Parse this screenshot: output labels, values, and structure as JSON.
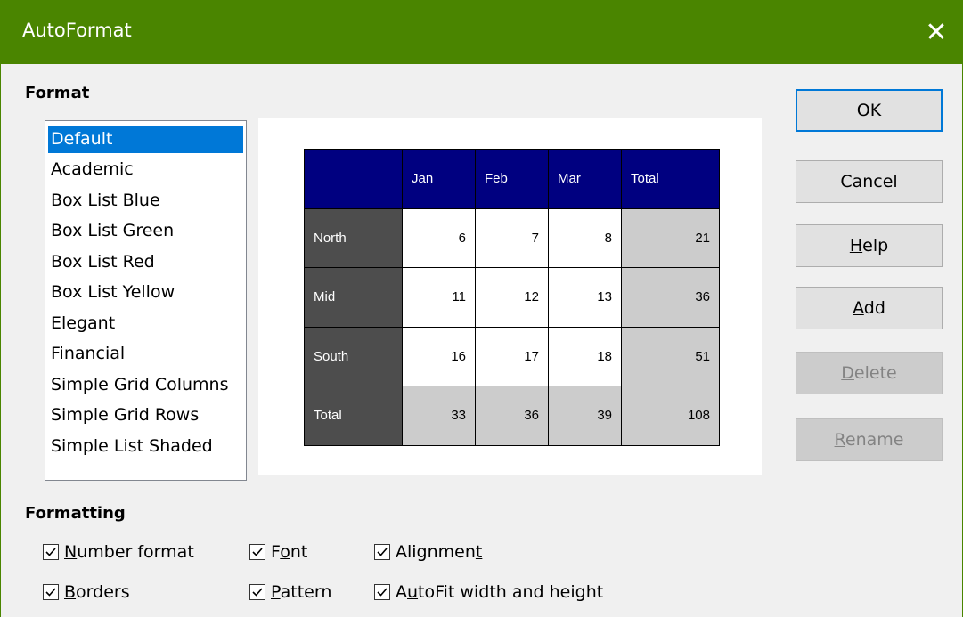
{
  "window": {
    "title": "AutoFormat",
    "close_glyph": "✕",
    "title_bar_color": "#4a8500"
  },
  "format_section": {
    "label": "Format",
    "items": [
      "Default",
      "Academic",
      "Box List Blue",
      "Box List Green",
      "Box List Red",
      "Box List Yellow",
      "Elegant",
      "Financial",
      "Simple Grid Columns",
      "Simple Grid Rows",
      "Simple List Shaded"
    ],
    "selected": "Default"
  },
  "preview": {
    "columns": [
      "",
      "Jan",
      "Feb",
      "Mar",
      "Total"
    ],
    "rows": [
      {
        "label": "North",
        "values": [
          "6",
          "7",
          "8"
        ],
        "total": "21"
      },
      {
        "label": "Mid",
        "values": [
          "11",
          "12",
          "13"
        ],
        "total": "36"
      },
      {
        "label": "South",
        "values": [
          "16",
          "17",
          "18"
        ],
        "total": "51"
      },
      {
        "label": "Total",
        "values": [
          "33",
          "36",
          "39"
        ],
        "total": "108"
      }
    ],
    "colors": {
      "header": "#000080",
      "row_header": "#4d4d4d",
      "total": "#cccccc"
    }
  },
  "buttons": {
    "ok": {
      "label": "OK",
      "mnemonic": ""
    },
    "cancel": {
      "label": "Cancel"
    },
    "help": {
      "pre": "",
      "key": "H",
      "post": "elp"
    },
    "add": {
      "pre": "",
      "key": "A",
      "post": "dd"
    },
    "delete": {
      "pre": "",
      "key": "D",
      "post": "elete"
    },
    "rename": {
      "pre": "",
      "key": "R",
      "post": "ename"
    }
  },
  "formatting_section": {
    "label": "Formatting",
    "options": {
      "number_format": {
        "pre": "",
        "key": "N",
        "post": "umber format",
        "checked": true
      },
      "font": {
        "pre": "F",
        "key": "o",
        "post": "nt",
        "checked": true
      },
      "alignment": {
        "pre": "Alignmen",
        "key": "t",
        "post": "",
        "checked": true
      },
      "borders": {
        "pre": "",
        "key": "B",
        "post": "orders",
        "checked": true
      },
      "pattern": {
        "pre": "",
        "key": "P",
        "post": "attern",
        "checked": true
      },
      "autofit": {
        "pre": "A",
        "key": "u",
        "post": "toFit width and height",
        "checked": true
      }
    }
  },
  "accent_color": "#0078d7"
}
